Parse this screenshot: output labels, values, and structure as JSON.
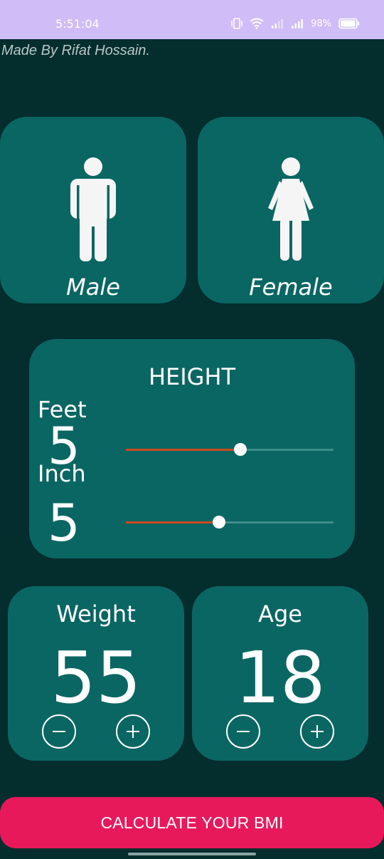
{
  "status_bar": {
    "time": "5:51:04",
    "battery_percent": "98%",
    "icons": [
      "vibrate-icon",
      "wifi-icon",
      "signal-icon",
      "signal-icon",
      "battery-icon"
    ]
  },
  "credit": "Made By Rifat Hossain.",
  "gender": {
    "male_label": "Male",
    "female_label": "Female"
  },
  "height": {
    "title": "HEIGHT",
    "feet_label": "Feet",
    "feet_value": "5",
    "feet_slider_fraction": 0.55,
    "inch_label": "Inch",
    "inch_value": "5",
    "inch_slider_fraction": 0.45
  },
  "weight": {
    "title": "Weight",
    "value": "55"
  },
  "age": {
    "title": "Age",
    "value": "18"
  },
  "calculate_button": "CALCULATE YOUR BMI",
  "colors": {
    "background": "#042d2d",
    "card": "#0a6663",
    "accent_button": "#e8195a",
    "slider_active": "#cb4a1f",
    "status_bar": "#cfbdf7"
  }
}
